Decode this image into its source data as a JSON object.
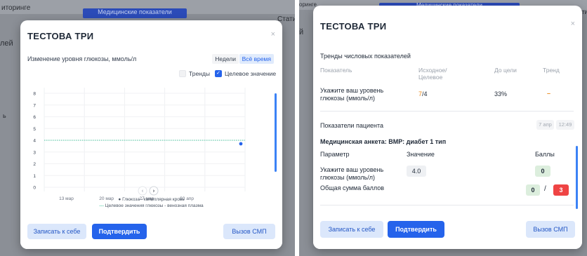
{
  "left": {
    "background": {
      "text_left": "иторинге",
      "tab_label": "Медицинские показатели",
      "text_right": "Стати",
      "side_text1": "лей",
      "side_text2": "ь"
    },
    "modal": {
      "title": "ТЕСТОВА ТРИ",
      "close_symbol": "×",
      "chart_title": "Изменение уровня глюкозы, ммоль/л",
      "segment_weeks": "Недели",
      "segment_all_time": "Всё время",
      "checkbox_trends": "Тренды",
      "checkbox_target": "Целевое значение",
      "checkbox_check": "✓",
      "nav_prev": "‹",
      "nav_next": "›",
      "legend_dot": "●",
      "legend_dash": "---",
      "legend_capillary": "Глюкоза - капиллярная кровь",
      "legend_target": "Целевое значения глюкозы - венозная плазма",
      "btn_save": "Записать к себе",
      "btn_confirm": "Подтвердить",
      "btn_ambulance": "Вызов СМП"
    },
    "chart_data": {
      "type": "line",
      "title": "Изменение уровня глюкозы, ммоль/л",
      "x_ticks": [
        "13 мар",
        "20 мар",
        "27 мар",
        "03 апр"
      ],
      "y_ticks": [
        0,
        1,
        2,
        3,
        4,
        5,
        6,
        7,
        8
      ],
      "ylim": [
        0,
        8
      ],
      "grid": true,
      "series": [
        {
          "name": "Глюкоза - капиллярная кровь",
          "kind": "scatter",
          "color": "#2563eb",
          "x": [
            "07 апр"
          ],
          "y": [
            4.0
          ]
        },
        {
          "name": "Целевое значения глюкозы - венозная плазма",
          "kind": "dashed-line",
          "color": "#10b981",
          "y_constant": 4.0
        }
      ]
    }
  },
  "right": {
    "background": {
      "text_left": "оринге",
      "tab_label": "Медицинские показатели",
      "text_right": "Стати",
      "side_text": "й"
    },
    "modal": {
      "title": "ТЕСТОВА ТРИ",
      "close_symbol": "×",
      "trends_title": "Тренды числовых показателей",
      "col_indicator": "Показатель",
      "col_initial_line1": "Исходное/",
      "col_initial_line2": "Целевое",
      "col_to_goal": "До цели",
      "col_trend": "Тренд",
      "row_label_line1": "Укажите ваш уровень",
      "row_label_line2": "глюкозы (ммоль/л)",
      "row_initial": "7",
      "row_separator": "/",
      "row_target": "4",
      "row_to_goal": "33%",
      "row_trend": "–",
      "patient_title": "Показатели пациента",
      "chip_date": "7 апр",
      "chip_time": "12:49",
      "questionnaire": "Медицинская анкета: ВМР: диабет 1 тип",
      "col_param": "Параметр",
      "col_value": "Значение",
      "col_score": "Баллы",
      "param_line1": "Укажите ваш уровень",
      "param_line2": "глюкозы (ммоль/л)",
      "param_value": "4.0",
      "param_score": "0",
      "total_label": "Общая сумма баллов",
      "total_score": "0",
      "total_slash": "/",
      "total_max": "3",
      "btn_save": "Записать к себе",
      "btn_confirm": "Подтвердить",
      "btn_ambulance": "Вызов СМП"
    }
  },
  "colors": {
    "accent": "#2563eb",
    "orange": "#ea8a1b",
    "target_line": "#10b981",
    "danger": "#ef4444"
  }
}
